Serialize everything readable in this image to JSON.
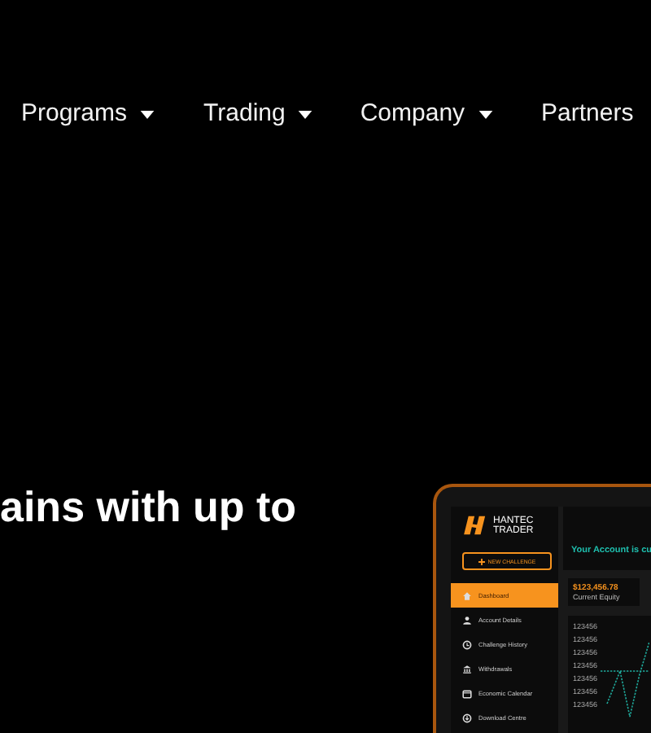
{
  "nav": {
    "items": [
      {
        "label": "Programs",
        "dropdown": true
      },
      {
        "label": "Trading",
        "dropdown": true
      },
      {
        "label": "Company",
        "dropdown": true
      },
      {
        "label": "Partners",
        "dropdown": false
      }
    ]
  },
  "hero": {
    "headline": "ains with up to"
  },
  "device": {
    "brand": [
      "HANTEC",
      "TRADER"
    ],
    "new_button": "NEW CHALLENGE",
    "sidebar": [
      {
        "label": "Dashboard",
        "kind": "home",
        "selected": true
      },
      {
        "label": "Account Details",
        "kind": "user",
        "selected": false
      },
      {
        "label": "Challenge History",
        "kind": "history",
        "selected": false
      },
      {
        "label": "Withdrawals",
        "kind": "bank",
        "selected": false
      },
      {
        "label": "Economic Calendar",
        "kind": "calendar",
        "selected": false
      },
      {
        "label": "Download Centre",
        "kind": "download",
        "selected": false
      }
    ],
    "header": "Your Account is cu",
    "stat": {
      "value": "$123,456.78",
      "label": "Current Equity"
    },
    "axis_labels": [
      "123456",
      "123456",
      "123456",
      "123456",
      "123456",
      "123456",
      "123456"
    ]
  }
}
